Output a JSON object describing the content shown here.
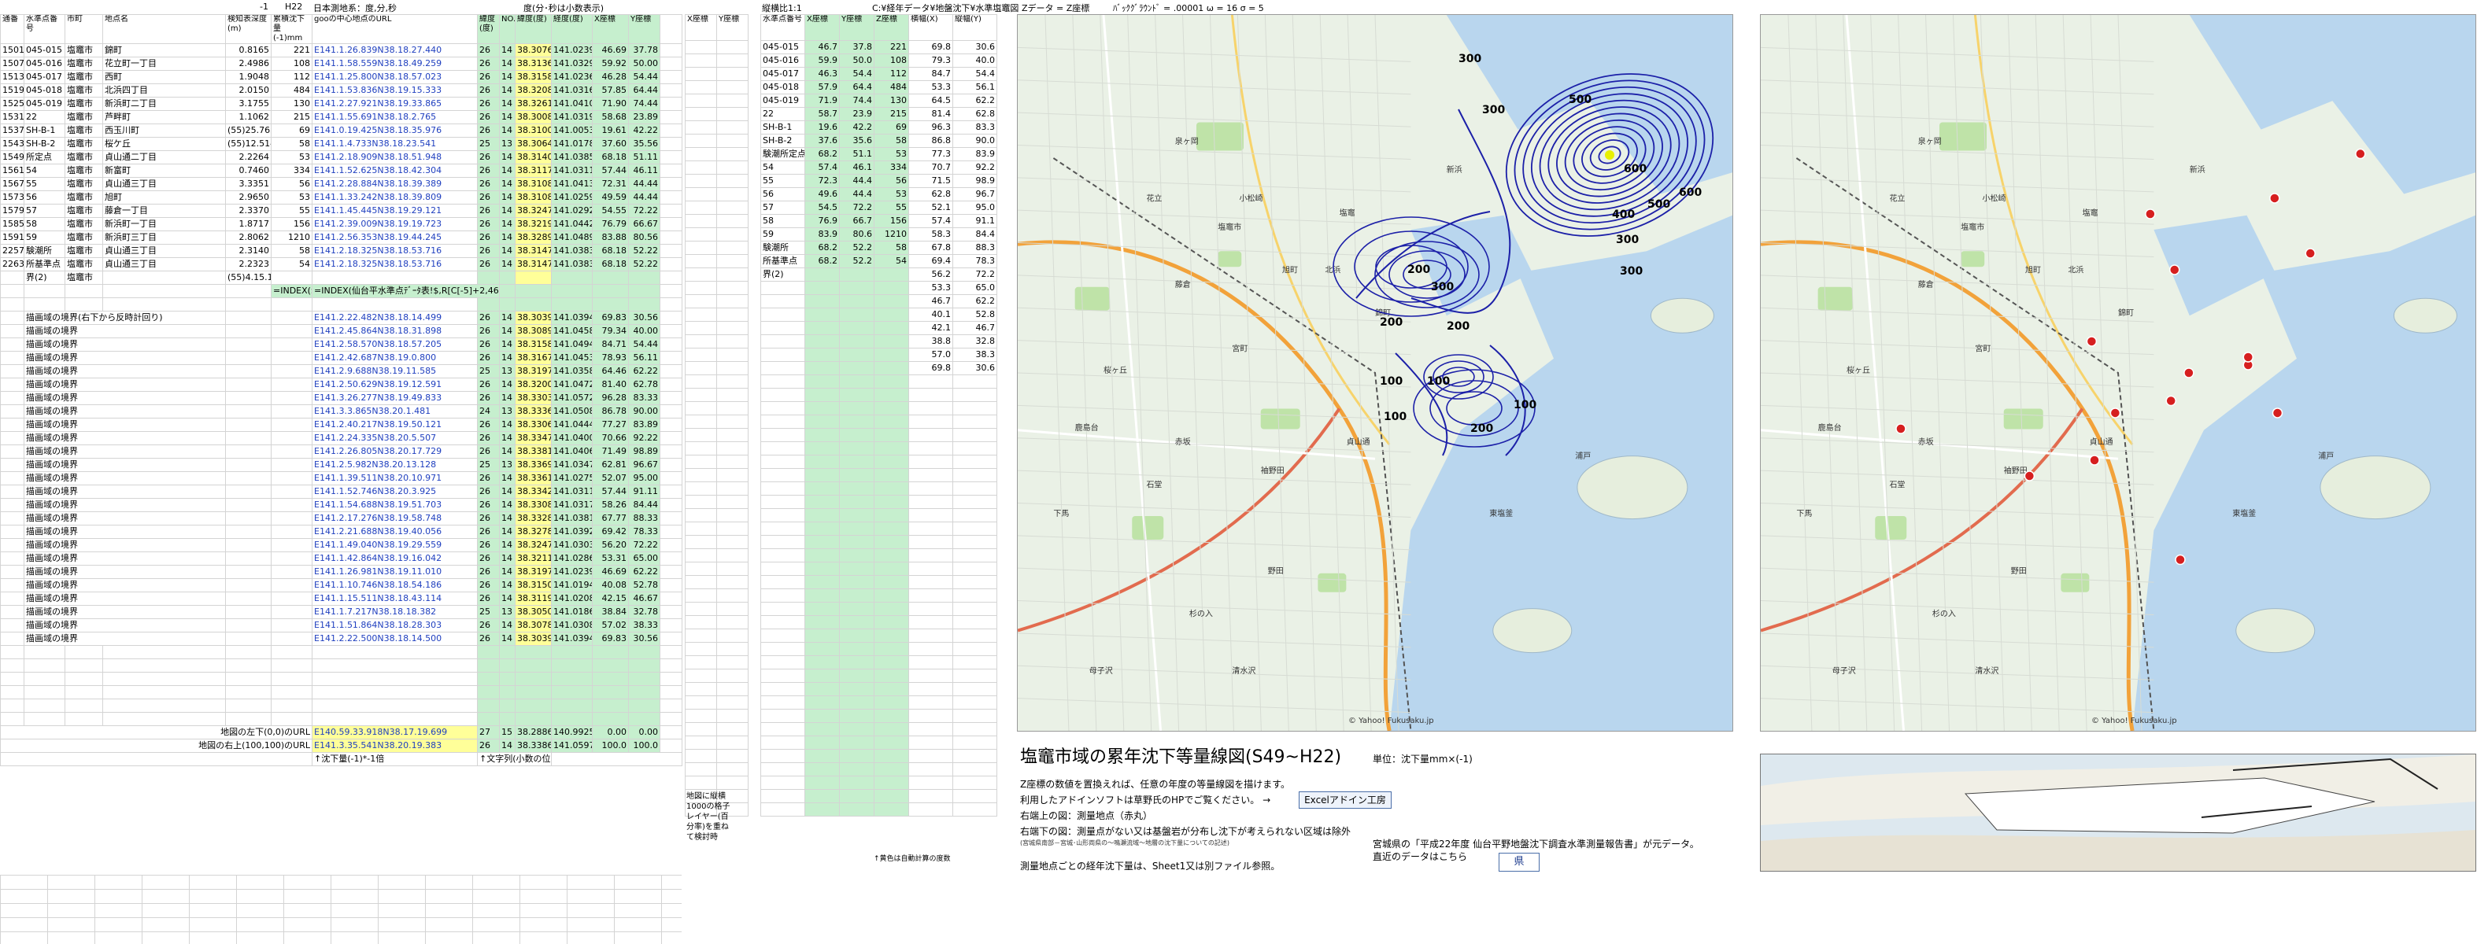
{
  "top_labels": {
    "col_minus1": "-1",
    "h22": "H22",
    "coord_hdr": "日本測地系：度,分,秒",
    "deg_hdr": "度(分･秒は小数表示)",
    "path": "C:¥経年データ¥地盤沈下¥水準塩竈図",
    "z_data": "Zデータ = Z座標",
    "bg_info": "ﾊﾞｯｸｸﾞﾗｳﾝﾄﾞ = .00001 ω = 16  σ = 5",
    "scale_label": "縦横比1:1"
  },
  "headers": {
    "c0": "通番",
    "c1": "水準点番号",
    "c2": "市町",
    "c3": "地点名",
    "c4": "検知表深度(m)",
    "c5": "累積沈下量(-1)mm",
    "c6": "gooの中心地点のURL",
    "c7": "緯度(度)",
    "c8": "NO.",
    "c9": "",
    "c10": "緯度(度)",
    "c11": "経度(度)",
    "c12": "X座標",
    "c13": "Y座標",
    "c14": "X座標",
    "c15": "Y座標"
  },
  "rows": [
    {
      "n": "1501",
      "code": "045-015",
      "city": "塩竈市",
      "name": "錦町",
      "d": "0.8165",
      "v": "221",
      "url": "E141.1.26.839N38.18.27.440",
      "a": "26",
      "b": "14",
      "lat": "38.3076",
      "lon": "141.0239",
      "x": "46.69",
      "y": "37.78"
    },
    {
      "n": "1507",
      "code": "045-016",
      "city": "塩竈市",
      "name": "花立町一丁目",
      "d": "2.4986",
      "v": "108",
      "url": "E141.1.58.559N38.18.49.259",
      "a": "26",
      "b": "14",
      "lat": "38.3136",
      "lon": "141.0329",
      "x": "59.92",
      "y": "50.00"
    },
    {
      "n": "1513",
      "code": "045-017",
      "city": "塩竈市",
      "name": "西町",
      "d": "1.9048",
      "v": "112",
      "url": "E141.1.25.800N38.18.57.023",
      "a": "26",
      "b": "14",
      "lat": "38.3158",
      "lon": "141.0236",
      "x": "46.28",
      "y": "54.44"
    },
    {
      "n": "1519",
      "code": "045-018",
      "city": "塩竈市",
      "name": "北浜四丁目",
      "d": "2.0150",
      "v": "484",
      "url": "E141.1.53.836N38.19.15.333",
      "a": "26",
      "b": "14",
      "lat": "38.3208",
      "lon": "141.0316",
      "x": "57.85",
      "y": "64.44"
    },
    {
      "n": "1525",
      "code": "045-019",
      "city": "塩竈市",
      "name": "新浜町二丁目",
      "d": "3.1755",
      "v": "130",
      "url": "E141.2.27.921N38.19.33.865",
      "a": "26",
      "b": "14",
      "lat": "38.3261",
      "lon": "141.0410",
      "x": "71.90",
      "y": "74.44"
    },
    {
      "n": "1531",
      "code": "22",
      "city": "塩竈市",
      "name": "芦畔町",
      "d": "1.1062",
      "v": "215",
      "url": "E141.1.55.691N38.18.2.765",
      "a": "26",
      "b": "14",
      "lat": "38.3008",
      "lon": "141.0319",
      "x": "58.68",
      "y": "23.89"
    },
    {
      "n": "1537",
      "code": "SH-B-1",
      "city": "塩竈市",
      "name": "西玉川町",
      "d": "(55)25.7632",
      "v": "69",
      "url": "E141.0.19.425N38.18.35.976",
      "a": "26",
      "b": "14",
      "lat": "38.3100",
      "lon": "141.0053",
      "x": "19.61",
      "y": "42.22"
    },
    {
      "n": "1543",
      "code": "SH-B-2",
      "city": "塩竈市",
      "name": "桜ケ丘",
      "d": "(55)12.5148",
      "v": "58",
      "url": "E141.1.4.733N38.18.23.541",
      "a": "25",
      "b": "13",
      "lat": "38.3064",
      "lon": "141.0178",
      "x": "37.60",
      "y": "35.56"
    },
    {
      "n": "1549",
      "code": "所定点",
      "city": "塩竈市",
      "name": "貞山通二丁目",
      "d": "2.2264",
      "v": "53",
      "url": "E141.2.18.909N38.18.51.948",
      "a": "26",
      "b": "14",
      "lat": "38.3140",
      "lon": "141.0385",
      "x": "68.18",
      "y": "51.11"
    },
    {
      "n": "1561",
      "code": "54",
      "city": "塩竈市",
      "name": "新富町",
      "d": "0.7460",
      "v": "334",
      "url": "E141.1.52.625N38.18.42.304",
      "a": "26",
      "b": "14",
      "lat": "38.3117",
      "lon": "141.0311",
      "x": "57.44",
      "y": "46.11"
    },
    {
      "n": "1567",
      "code": "55",
      "city": "塩竈市",
      "name": "貞山通三丁目",
      "d": "3.3351",
      "v": "56",
      "url": "E141.2.28.884N38.18.39.389",
      "a": "26",
      "b": "14",
      "lat": "38.3108",
      "lon": "141.0413",
      "x": "72.31",
      "y": "44.44"
    },
    {
      "n": "1573",
      "code": "56",
      "city": "塩竈市",
      "name": "旭町",
      "d": "2.9650",
      "v": "53",
      "url": "E141.1.33.242N38.18.39.809",
      "a": "26",
      "b": "14",
      "lat": "38.3108",
      "lon": "141.0259",
      "x": "49.59",
      "y": "44.44"
    },
    {
      "n": "1579",
      "code": "57",
      "city": "塩竈市",
      "name": "藤倉一丁目",
      "d": "2.3370",
      "v": "55",
      "url": "E141.1.45.445N38.19.29.121",
      "a": "26",
      "b": "14",
      "lat": "38.3247",
      "lon": "141.0292",
      "x": "54.55",
      "y": "72.22"
    },
    {
      "n": "1585",
      "code": "58",
      "city": "塩竈市",
      "name": "新浜町一丁目",
      "d": "1.8717",
      "v": "156",
      "url": "E141.2.39.009N38.19.19.723",
      "a": "26",
      "b": "14",
      "lat": "38.3219",
      "lon": "141.0442",
      "x": "76.79",
      "y": "66.67"
    },
    {
      "n": "1591",
      "code": "59",
      "city": "塩竈市",
      "name": "新浜町三丁目",
      "d": "2.8062",
      "v": "1210",
      "url": "E141.2.56.353N38.19.44.245",
      "a": "26",
      "b": "14",
      "lat": "38.3289",
      "lon": "141.0489",
      "x": "83.88",
      "y": "80.56"
    },
    {
      "n": "2257",
      "code": "験潮所",
      "city": "塩竈市",
      "name": "貞山通三丁目",
      "d": "2.3140",
      "v": "58",
      "url": "E141.2.18.325N38.18.53.716",
      "a": "26",
      "b": "14",
      "lat": "38.3147",
      "lon": "141.0383",
      "x": "68.18",
      "y": "52.22"
    },
    {
      "n": "2263",
      "code": "所基準点",
      "city": "塩竈市",
      "name": "貞山通三丁目",
      "d": "2.2323",
      "v": "54",
      "url": "E141.2.18.325N38.18.53.716",
      "a": "26",
      "b": "14",
      "lat": "38.3147",
      "lon": "141.0383",
      "x": "68.18",
      "y": "52.22"
    },
    {
      "n": "",
      "code": "界(2)",
      "city": "塩竈市",
      "name": "",
      "d": "(55)4.15.1341",
      "v": "",
      "url": "",
      "a": "",
      "b": "",
      "lat": "",
      "lon": "",
      "x": "",
      "y": ""
    }
  ],
  "formula_a": "=INDEX($",
  "formula_b": "=INDEX(仙台平水準点ﾃﾞｰﾀ表!$,R[C[-5]+2,46)*-1",
  "boundary_label": "描画域の境界",
  "boundary_first_label": "描画域の境界(右下から反時計回り)",
  "boundary_rows": [
    {
      "url": "E141.2.22.482N38.18.14.499",
      "a": "26",
      "b": "14",
      "lat": "38.3039",
      "lon": "141.0394",
      "x": "69.83",
      "y": "30.56"
    },
    {
      "url": "E141.2.45.864N38.18.31.898",
      "a": "26",
      "b": "14",
      "lat": "38.3089",
      "lon": "141.0458",
      "x": "79.34",
      "y": "40.00"
    },
    {
      "url": "E141.2.58.570N38.18.57.205",
      "a": "26",
      "b": "14",
      "lat": "38.3158",
      "lon": "141.0494",
      "x": "84.71",
      "y": "54.44"
    },
    {
      "url": "E141.2.42.687N38.19.0.800",
      "a": "26",
      "b": "14",
      "lat": "38.3167",
      "lon": "141.0453",
      "x": "78.93",
      "y": "56.11"
    },
    {
      "url": "E141.2.9.688N38.19.11.585",
      "a": "25",
      "b": "13",
      "lat": "38.3197",
      "lon": "141.0358",
      "x": "64.46",
      "y": "62.22"
    },
    {
      "url": "E141.2.50.629N38.19.12.591",
      "a": "26",
      "b": "14",
      "lat": "38.3200",
      "lon": "141.0472",
      "x": "81.40",
      "y": "62.78"
    },
    {
      "url": "E141.3.26.277N38.19.49.833",
      "a": "26",
      "b": "14",
      "lat": "38.3303",
      "lon": "141.0572",
      "x": "96.28",
      "y": "83.33"
    },
    {
      "url": "E141.3.3.865N38.20.1.481",
      "a": "24",
      "b": "13",
      "lat": "38.3336",
      "lon": "141.0508",
      "x": "86.78",
      "y": "90.00"
    },
    {
      "url": "E141.2.40.217N38.19.50.121",
      "a": "26",
      "b": "14",
      "lat": "38.3306",
      "lon": "141.0444",
      "x": "77.27",
      "y": "83.89"
    },
    {
      "url": "E141.2.24.335N38.20.5.507",
      "a": "26",
      "b": "14",
      "lat": "38.3347",
      "lon": "141.0400",
      "x": "70.66",
      "y": "92.22"
    },
    {
      "url": "E141.2.26.805N38.20.17.729",
      "a": "26",
      "b": "14",
      "lat": "38.3381",
      "lon": "141.0406",
      "x": "71.49",
      "y": "98.89"
    },
    {
      "url": "E141.2.5.982N38.20.13.128",
      "a": "25",
      "b": "13",
      "lat": "38.3369",
      "lon": "141.0347",
      "x": "62.81",
      "y": "96.67"
    },
    {
      "url": "E141.1.39.511N38.20.10.971",
      "a": "26",
      "b": "14",
      "lat": "38.3361",
      "lon": "141.0275",
      "x": "52.07",
      "y": "95.00"
    },
    {
      "url": "E141.1.52.746N38.20.3.925",
      "a": "26",
      "b": "14",
      "lat": "38.3342",
      "lon": "141.0311",
      "x": "57.44",
      "y": "91.11"
    },
    {
      "url": "E141.1.54.688N38.19.51.703",
      "a": "26",
      "b": "14",
      "lat": "38.3308",
      "lon": "141.0317",
      "x": "58.26",
      "y": "84.44"
    },
    {
      "url": "E141.2.17.276N38.19.58.748",
      "a": "26",
      "b": "14",
      "lat": "38.3328",
      "lon": "141.0381",
      "x": "67.77",
      "y": "88.33"
    },
    {
      "url": "E141.2.21.688N38.19.40.056",
      "a": "26",
      "b": "14",
      "lat": "38.3278",
      "lon": "141.0392",
      "x": "69.42",
      "y": "78.33"
    },
    {
      "url": "E141.1.49.040N38.19.29.559",
      "a": "26",
      "b": "14",
      "lat": "38.3247",
      "lon": "141.0303",
      "x": "56.20",
      "y": "72.22"
    },
    {
      "url": "E141.1.42.864N38.19.16.042",
      "a": "26",
      "b": "14",
      "lat": "38.3211",
      "lon": "141.0286",
      "x": "53.31",
      "y": "65.00"
    },
    {
      "url": "E141.1.26.981N38.19.11.010",
      "a": "26",
      "b": "14",
      "lat": "38.3197",
      "lon": "141.0239",
      "x": "46.69",
      "y": "62.22"
    },
    {
      "url": "E141.1.10.746N38.18.54.186",
      "a": "26",
      "b": "14",
      "lat": "38.3150",
      "lon": "141.0194",
      "x": "40.08",
      "y": "52.78"
    },
    {
      "url": "E141.1.15.511N38.18.43.114",
      "a": "26",
      "b": "14",
      "lat": "38.3119",
      "lon": "141.0208",
      "x": "42.15",
      "y": "46.67"
    },
    {
      "url": "E141.1.7.217N38.18.18.382",
      "a": "25",
      "b": "13",
      "lat": "38.3050",
      "lon": "141.0186",
      "x": "38.84",
      "y": "32.78"
    },
    {
      "url": "E141.1.51.864N38.18.28.303",
      "a": "26",
      "b": "14",
      "lat": "38.3078",
      "lon": "141.0308",
      "x": "57.02",
      "y": "38.33"
    },
    {
      "url": "E141.2.22.500N38.18.14.500",
      "a": "26",
      "b": "14",
      "lat": "38.3039",
      "lon": "141.0394",
      "x": "69.83",
      "y": "30.56"
    }
  ],
  "bottom_rows": [
    {
      "label": "地図の左下(0,0)のURL",
      "url": "E140.59.33.918N38.17.19.699",
      "a": "27",
      "b": "15",
      "lat": "38.2886",
      "lon": "140.9925",
      "x": "0.00",
      "y": "0.00"
    },
    {
      "label": "地図の右上(100,100)のURL",
      "url": "E141.3.35.541N38.20.19.383",
      "a": "26",
      "b": "14",
      "lat": "38.3386",
      "lon": "141.0597",
      "x": "100.0",
      "y": "100.0"
    }
  ],
  "footnotes": {
    "f1": "↑沈下量(-1)*-1倍",
    "f2": "↑文字列(小数の位置で度数を求める)",
    "f3": "↑黄色は自動計算の度数"
  },
  "right_table": {
    "headers": [
      "水準点番号",
      "X座標",
      "Y座標",
      "Z座標",
      "横幅(X)",
      "縦幅(Y)"
    ],
    "rows": [
      [
        "045-015",
        "46.7",
        "37.8",
        "221",
        "69.8",
        "30.6"
      ],
      [
        "045-016",
        "59.9",
        "50.0",
        "108",
        "79.3",
        "40.0"
      ],
      [
        "045-017",
        "46.3",
        "54.4",
        "112",
        "84.7",
        "54.4"
      ],
      [
        "045-018",
        "57.9",
        "64.4",
        "484",
        "53.3",
        "56.1"
      ],
      [
        "045-019",
        "71.9",
        "74.4",
        "130",
        "64.5",
        "62.2"
      ],
      [
        "22",
        "58.7",
        "23.9",
        "215",
        "81.4",
        "62.8"
      ],
      [
        "SH-B-1",
        "19.6",
        "42.2",
        "69",
        "96.3",
        "83.3"
      ],
      [
        "SH-B-2",
        "37.6",
        "35.6",
        "58",
        "86.8",
        "90.0"
      ],
      [
        "験潮所定点",
        "68.2",
        "51.1",
        "53",
        "77.3",
        "83.9"
      ],
      [
        "54",
        "57.4",
        "46.1",
        "334",
        "70.7",
        "92.2"
      ],
      [
        "55",
        "72.3",
        "44.4",
        "56",
        "71.5",
        "98.9"
      ],
      [
        "56",
        "49.6",
        "44.4",
        "53",
        "62.8",
        "96.7"
      ],
      [
        "57",
        "54.5",
        "72.2",
        "55",
        "52.1",
        "95.0"
      ],
      [
        "58",
        "76.9",
        "66.7",
        "156",
        "57.4",
        "91.1"
      ],
      [
        "59",
        "83.9",
        "80.6",
        "1210",
        "58.3",
        "84.4"
      ],
      [
        "験潮所",
        "68.2",
        "52.2",
        "58",
        "67.8",
        "88.3"
      ],
      [
        "所基準点",
        "68.2",
        "52.2",
        "54",
        "69.4",
        "78.3"
      ],
      [
        "界(2)",
        "",
        "",
        "",
        "56.2",
        "72.2"
      ],
      [
        "",
        "",
        "",
        "",
        "53.3",
        "65.0"
      ],
      [
        "",
        "",
        "",
        "",
        "46.7",
        "62.2"
      ],
      [
        "",
        "",
        "",
        "",
        "40.1",
        "52.8"
      ],
      [
        "",
        "",
        "",
        "",
        "42.1",
        "46.7"
      ],
      [
        "",
        "",
        "",
        "",
        "38.8",
        "32.8"
      ],
      [
        "",
        "",
        "",
        "",
        "57.0",
        "38.3"
      ],
      [
        "",
        "",
        "",
        "",
        "69.8",
        "30.6"
      ]
    ]
  },
  "side_header": {
    "xcol": "X座標",
    "ycol": "Y座標"
  },
  "side_note": "地図に縦横1000の格子レイヤー(百分率)を重ねて検討時",
  "map": {
    "credit": "© Yahoo! Fukusaku.jp",
    "contours": [
      "300",
      "300",
      "500",
      "600",
      "600",
      "500",
      "400",
      "300",
      "300",
      "200",
      "200",
      "300",
      "200",
      "100",
      "100",
      "200",
      "100",
      "100"
    ],
    "places": [
      "塩竈市",
      "小松崎",
      "泉ヶ岡",
      "塩竈",
      "北浜",
      "錦町",
      "旭町",
      "新浜",
      "藤倉",
      "花立",
      "宮町",
      "桜ヶ丘",
      "鹿島台",
      "赤坂",
      "石堂",
      "袖野田",
      "浦戸",
      "東塩釜",
      "下馬",
      "杉の入",
      "野田",
      "貞山通",
      "母子沢",
      "清水沢"
    ]
  },
  "bottom_text": {
    "title": "塩竈市域の累年沈下等量線図(S49~H22)",
    "unit": "単位：沈下量mm×(-1)",
    "l1": "Z座標の数値を置換えれば、任意の年度の等量線図を描けます。",
    "l2": "利用したアドインソフトは草野氏のHPでご覧ください。  →",
    "excel_btn": "Excelアドイン工房",
    "l3": "右端上の図：測量地点（赤丸）",
    "l4": "右端下の図：測量点がない又は基盤岩が分布し沈下が考えられない区域は除外",
    "l4b": "(宮城県南部－宮城･山形両県の～鳴瀬流域～地層の沈下量についての記述)",
    "l5": "測量地点ごとの経年沈下量は、Sheet1又は別ファイル参照。",
    "source": "宮城県の「平成22年度 仙台平野地盤沈下調査水準測量報告書」が元データ。",
    "source2": "直近のデータはこちら",
    "link_btn": "県"
  }
}
